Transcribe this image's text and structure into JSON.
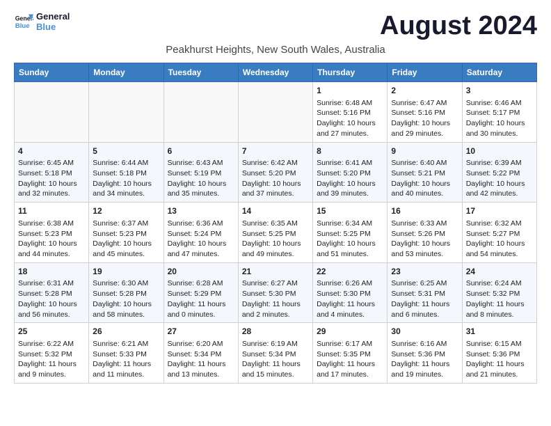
{
  "logo": {
    "line1": "General",
    "line2": "Blue"
  },
  "title": "August 2024",
  "subtitle": "Peakhurst Heights, New South Wales, Australia",
  "headers": [
    "Sunday",
    "Monday",
    "Tuesday",
    "Wednesday",
    "Thursday",
    "Friday",
    "Saturday"
  ],
  "weeks": [
    [
      {
        "day": "",
        "info": ""
      },
      {
        "day": "",
        "info": ""
      },
      {
        "day": "",
        "info": ""
      },
      {
        "day": "",
        "info": ""
      },
      {
        "day": "1",
        "info": "Sunrise: 6:48 AM\nSunset: 5:16 PM\nDaylight: 10 hours\nand 27 minutes."
      },
      {
        "day": "2",
        "info": "Sunrise: 6:47 AM\nSunset: 5:16 PM\nDaylight: 10 hours\nand 29 minutes."
      },
      {
        "day": "3",
        "info": "Sunrise: 6:46 AM\nSunset: 5:17 PM\nDaylight: 10 hours\nand 30 minutes."
      }
    ],
    [
      {
        "day": "4",
        "info": "Sunrise: 6:45 AM\nSunset: 5:18 PM\nDaylight: 10 hours\nand 32 minutes."
      },
      {
        "day": "5",
        "info": "Sunrise: 6:44 AM\nSunset: 5:18 PM\nDaylight: 10 hours\nand 34 minutes."
      },
      {
        "day": "6",
        "info": "Sunrise: 6:43 AM\nSunset: 5:19 PM\nDaylight: 10 hours\nand 35 minutes."
      },
      {
        "day": "7",
        "info": "Sunrise: 6:42 AM\nSunset: 5:20 PM\nDaylight: 10 hours\nand 37 minutes."
      },
      {
        "day": "8",
        "info": "Sunrise: 6:41 AM\nSunset: 5:20 PM\nDaylight: 10 hours\nand 39 minutes."
      },
      {
        "day": "9",
        "info": "Sunrise: 6:40 AM\nSunset: 5:21 PM\nDaylight: 10 hours\nand 40 minutes."
      },
      {
        "day": "10",
        "info": "Sunrise: 6:39 AM\nSunset: 5:22 PM\nDaylight: 10 hours\nand 42 minutes."
      }
    ],
    [
      {
        "day": "11",
        "info": "Sunrise: 6:38 AM\nSunset: 5:23 PM\nDaylight: 10 hours\nand 44 minutes."
      },
      {
        "day": "12",
        "info": "Sunrise: 6:37 AM\nSunset: 5:23 PM\nDaylight: 10 hours\nand 45 minutes."
      },
      {
        "day": "13",
        "info": "Sunrise: 6:36 AM\nSunset: 5:24 PM\nDaylight: 10 hours\nand 47 minutes."
      },
      {
        "day": "14",
        "info": "Sunrise: 6:35 AM\nSunset: 5:25 PM\nDaylight: 10 hours\nand 49 minutes."
      },
      {
        "day": "15",
        "info": "Sunrise: 6:34 AM\nSunset: 5:25 PM\nDaylight: 10 hours\nand 51 minutes."
      },
      {
        "day": "16",
        "info": "Sunrise: 6:33 AM\nSunset: 5:26 PM\nDaylight: 10 hours\nand 53 minutes."
      },
      {
        "day": "17",
        "info": "Sunrise: 6:32 AM\nSunset: 5:27 PM\nDaylight: 10 hours\nand 54 minutes."
      }
    ],
    [
      {
        "day": "18",
        "info": "Sunrise: 6:31 AM\nSunset: 5:28 PM\nDaylight: 10 hours\nand 56 minutes."
      },
      {
        "day": "19",
        "info": "Sunrise: 6:30 AM\nSunset: 5:28 PM\nDaylight: 10 hours\nand 58 minutes."
      },
      {
        "day": "20",
        "info": "Sunrise: 6:28 AM\nSunset: 5:29 PM\nDaylight: 11 hours\nand 0 minutes."
      },
      {
        "day": "21",
        "info": "Sunrise: 6:27 AM\nSunset: 5:30 PM\nDaylight: 11 hours\nand 2 minutes."
      },
      {
        "day": "22",
        "info": "Sunrise: 6:26 AM\nSunset: 5:30 PM\nDaylight: 11 hours\nand 4 minutes."
      },
      {
        "day": "23",
        "info": "Sunrise: 6:25 AM\nSunset: 5:31 PM\nDaylight: 11 hours\nand 6 minutes."
      },
      {
        "day": "24",
        "info": "Sunrise: 6:24 AM\nSunset: 5:32 PM\nDaylight: 11 hours\nand 8 minutes."
      }
    ],
    [
      {
        "day": "25",
        "info": "Sunrise: 6:22 AM\nSunset: 5:32 PM\nDaylight: 11 hours\nand 9 minutes."
      },
      {
        "day": "26",
        "info": "Sunrise: 6:21 AM\nSunset: 5:33 PM\nDaylight: 11 hours\nand 11 minutes."
      },
      {
        "day": "27",
        "info": "Sunrise: 6:20 AM\nSunset: 5:34 PM\nDaylight: 11 hours\nand 13 minutes."
      },
      {
        "day": "28",
        "info": "Sunrise: 6:19 AM\nSunset: 5:34 PM\nDaylight: 11 hours\nand 15 minutes."
      },
      {
        "day": "29",
        "info": "Sunrise: 6:17 AM\nSunset: 5:35 PM\nDaylight: 11 hours\nand 17 minutes."
      },
      {
        "day": "30",
        "info": "Sunrise: 6:16 AM\nSunset: 5:36 PM\nDaylight: 11 hours\nand 19 minutes."
      },
      {
        "day": "31",
        "info": "Sunrise: 6:15 AM\nSunset: 5:36 PM\nDaylight: 11 hours\nand 21 minutes."
      }
    ]
  ]
}
